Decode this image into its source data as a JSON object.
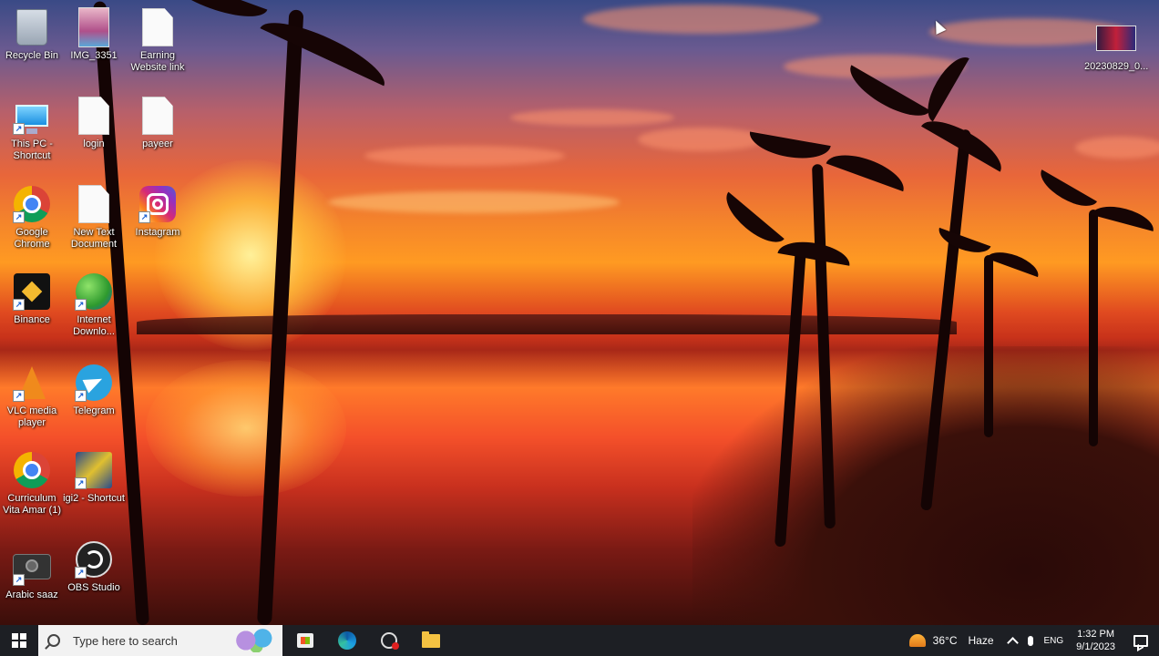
{
  "desktop": {
    "icons": [
      {
        "label": "Recycle Bin"
      },
      {
        "label": "IMG_3351"
      },
      {
        "label": "Earning Website link"
      },
      {
        "label": "This PC - Shortcut"
      },
      {
        "label": "login"
      },
      {
        "label": "payeer"
      },
      {
        "label": "Google Chrome"
      },
      {
        "label": "New Text Document"
      },
      {
        "label": "Instagram"
      },
      {
        "label": "Binance"
      },
      {
        "label": "Internet Downlo..."
      },
      {
        "label": "VLC media player"
      },
      {
        "label": "Telegram"
      },
      {
        "label": "Curriculum Vita Amar (1)"
      },
      {
        "label": "igi2 - Shortcut"
      },
      {
        "label": "Arabic saaz"
      },
      {
        "label": "OBS Studio"
      },
      {
        "label": "20230829_0..."
      }
    ]
  },
  "taskbar": {
    "search_placeholder": "Type here to search",
    "weather": {
      "temp": "36°C",
      "condition": "Haze"
    },
    "language": "ENG",
    "time": "1:32 PM",
    "date": "9/1/2023"
  },
  "colors": {
    "taskbar": "#1d1f24",
    "search_bg": "#f2f2f2"
  }
}
